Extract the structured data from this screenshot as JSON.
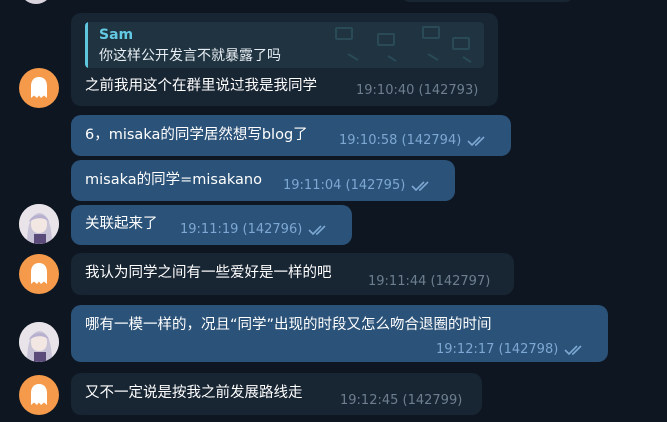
{
  "colors": {
    "background": "#0e1621",
    "incoming_bubble": "#182533",
    "outgoing_bubble": "#2b5278",
    "reply_accent": "#63c9e3",
    "ghost_avatar": "#f59a4a"
  },
  "messages": [
    {
      "reply": {
        "name": "Sam",
        "text": "你这样公开发言不就暴露了吗"
      },
      "text": "之前我用这个在群里说过我是我同学",
      "time": "19:10:40 (142793)",
      "avatar": "ghost-icon"
    },
    {
      "text": "6，misaka的同学居然想写blog了",
      "time": "19:10:58 (142794)"
    },
    {
      "text": "misaka的同学=misakano",
      "time": "19:11:04 (142795)"
    },
    {
      "text": "关联起来了",
      "time": "19:11:19 (142796)",
      "avatar": "anime-avatar"
    },
    {
      "text": "我认为同学之间有一些爱好是一样的吧",
      "time": "19:11:44 (142797)",
      "avatar": "ghost-icon"
    },
    {
      "text": "哪有一模一样的，况且“同学”出现的时段又怎么吻合退圈的时间",
      "time": "19:12:17 (142798)",
      "avatar": "anime-avatar"
    },
    {
      "text": "又不一定说是按我之前发展路线走",
      "time": "19:12:45 (142799)",
      "avatar": "ghost-icon"
    }
  ]
}
